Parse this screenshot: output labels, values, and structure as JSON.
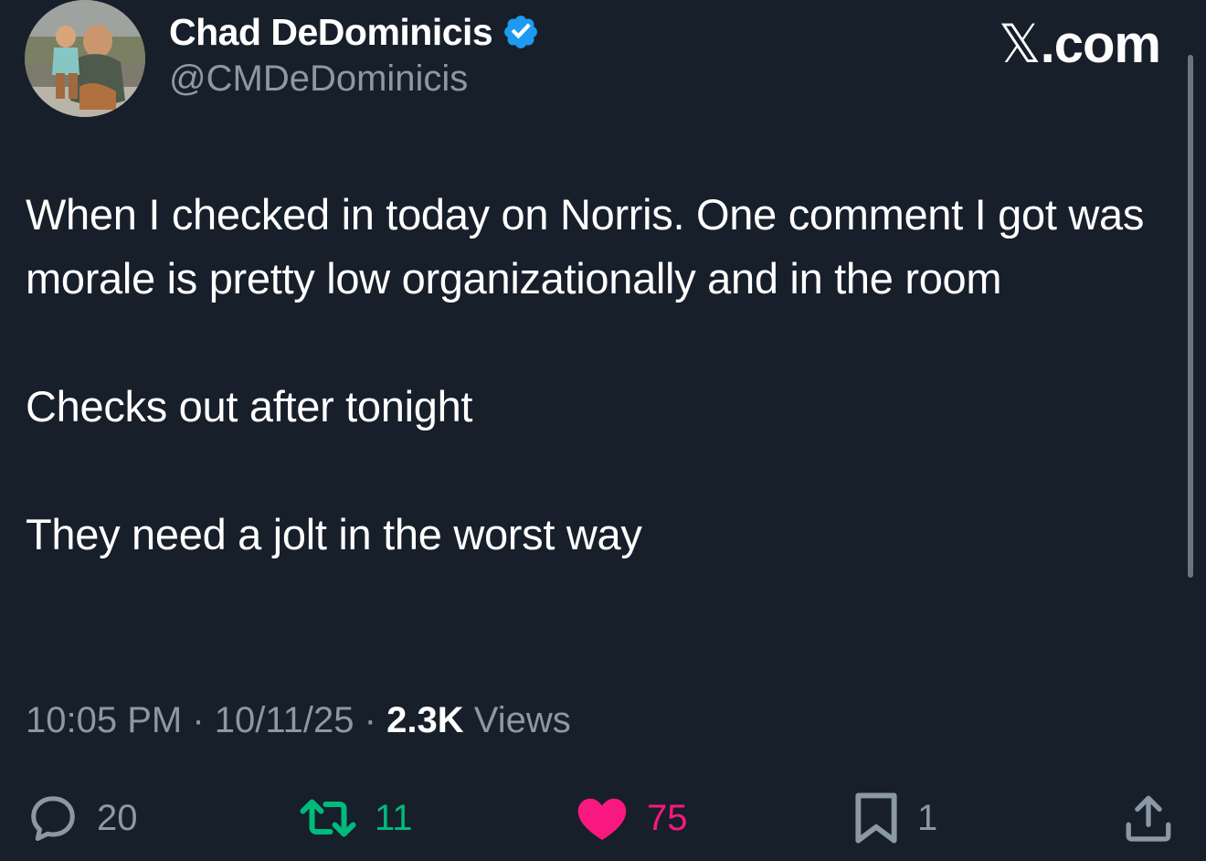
{
  "author": {
    "display_name": "Chad DeDominicis",
    "handle": "@CMDeDominicis",
    "verified": true
  },
  "brand": {
    "x_glyph": "𝕏",
    "suffix": ".com"
  },
  "tweet": {
    "paragraphs": [
      "When I checked in today on Norris. One comment I got was morale is pretty low organizationally and in the room",
      "Checks out after tonight",
      "They need a jolt in the worst way"
    ],
    "time": "10:05 PM",
    "date": "10/11/25",
    "separator": "·",
    "views_count": "2.3K",
    "views_label": "Views"
  },
  "actions": {
    "replies": "20",
    "retweets": "11",
    "likes": "75",
    "bookmarks": "1"
  },
  "colors": {
    "background": "#171f2a",
    "secondary_text": "#8b98a5",
    "verified_blue": "#1d9bf0",
    "retweet_green": "#00ba7c",
    "like_pink": "#f91880"
  },
  "icons": [
    "verified-badge-icon",
    "reply-icon",
    "retweet-icon",
    "heart-icon",
    "bookmark-icon",
    "share-icon"
  ]
}
